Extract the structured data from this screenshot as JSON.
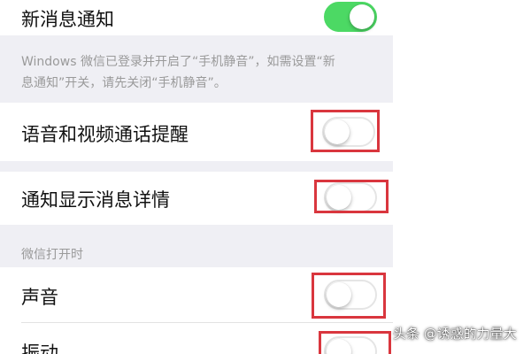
{
  "settings": {
    "new_message": {
      "label": "新消息通知",
      "toggle": "on"
    },
    "windows_note": {
      "line1": "Windows 微信已登录并开启了“手机静音”，如需设置“新",
      "line2": "息通知”开关，请先关闭“手机静音”。"
    },
    "call_reminder": {
      "label": "语音和视频通话提醒",
      "toggle": "off"
    },
    "message_details": {
      "label": "通知显示消息详情",
      "toggle": "off"
    },
    "section_when_open": {
      "header": "微信打开时"
    },
    "sound": {
      "label": "声音",
      "toggle": "off"
    },
    "vibration": {
      "label": "振动",
      "toggle": "off"
    }
  },
  "watermark": "头条 @诱惑的力量大",
  "colors": {
    "toggle_on": "#4cd964",
    "highlight": "#d9363e",
    "section_bg": "#efeff4"
  }
}
